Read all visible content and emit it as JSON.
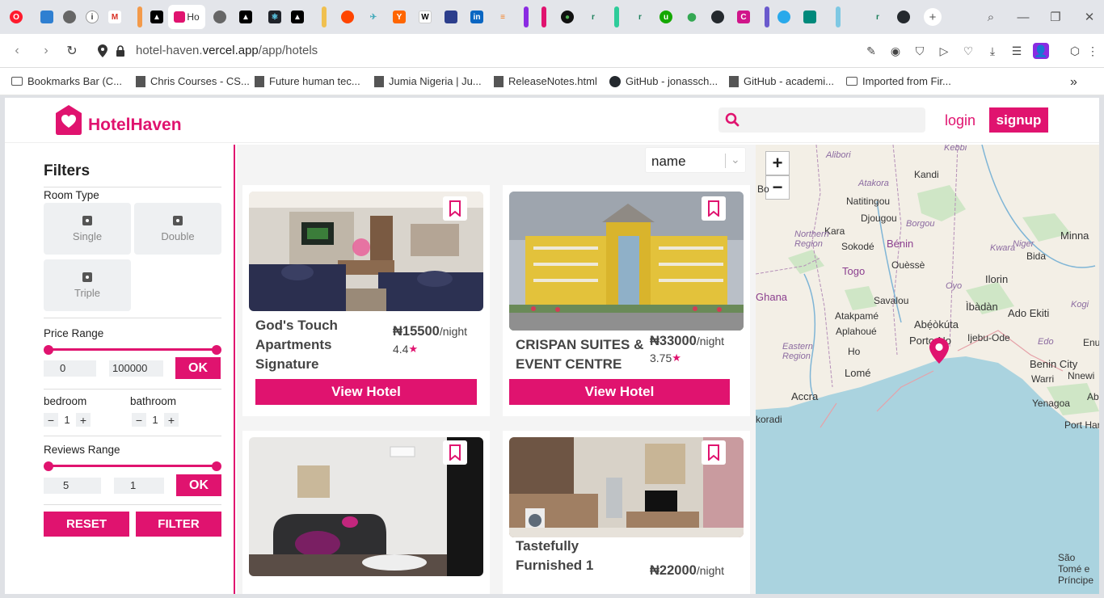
{
  "browser": {
    "active_tab_title": "Ho",
    "url_host": "hotel-haven.",
    "url_domain": "vercel.app",
    "url_path": "/app/hotels",
    "bookmarks": [
      "Bookmarks Bar (C...",
      "Chris Courses - CS...",
      "Future human tec...",
      "Jumia Nigeria | Ju...",
      "ReleaseNotes.html",
      "GitHub - jonassch...",
      "GitHub - academi...",
      "Imported from Fir..."
    ]
  },
  "header": {
    "brand": "HotelHaven",
    "search_placeholder": "",
    "login": "login",
    "signup": "signup"
  },
  "filters": {
    "title": "Filters",
    "room_type_label": "Room Type",
    "room_types": [
      "Single",
      "Double",
      "Triple"
    ],
    "price_range_label": "Price Range",
    "price_min": "0",
    "price_max": "100000",
    "ok": "OK",
    "bedroom_label": "bedroom",
    "bedroom_value": "1",
    "bathroom_label": "bathroom",
    "bathroom_value": "1",
    "minus": "−",
    "plus": "+",
    "reviews_range_label": "Reviews Range",
    "reviews_min": "5",
    "reviews_max": "1",
    "reset": "RESET",
    "filter": "FILTER"
  },
  "sort": {
    "selected": "name"
  },
  "hotels": [
    {
      "name": "God's Touch Apartments Signature",
      "currency": "₦",
      "price": "15500",
      "unit": "/night",
      "rating": "4.4",
      "button": "View Hotel"
    },
    {
      "name": "CRISPAN SUITES & EVENT CENTRE",
      "currency": "₦",
      "price": "33000",
      "unit": "/night",
      "rating": "3.75",
      "button": "View Hotel"
    },
    {
      "name": "",
      "price": "",
      "rating": "",
      "button": ""
    },
    {
      "name": "Tastefully Furnished 1",
      "currency": "₦",
      "price": "22000",
      "unit": "/night",
      "rating": "",
      "button": ""
    }
  ],
  "map": {
    "zoom_in": "+",
    "zoom_out": "−",
    "labels": {
      "alibori": "Alibori",
      "kebbi": "Kebbi",
      "kandi": "Kandi",
      "atakora": "Atakora",
      "bo": "Bo",
      "natitingou": "Natitingou",
      "kara": "Kara",
      "djougou": "Djougou",
      "borgou": "Borgou",
      "northern_region": "Northern Region",
      "benin": "Bénin",
      "sokode": "Sokodé",
      "niger": "Niger",
      "minna": "Minna",
      "kwara": "Kwara",
      "bida": "Bida",
      "togo": "Togo",
      "ouesse": "Ouèssè",
      "oyo": "Oyo",
      "ilorin": "Ilorin",
      "ghana": "Ghana",
      "savalou": "Savalou",
      "ibadan": "Ìbàdàn",
      "ado_ekiti": "Ado Ekiti",
      "kogi": "Kogi",
      "atakpame": "Atakpamé",
      "abeokuta": "Abẹ́òkúta",
      "aplahoue": "Aplahoué",
      "ijebu_ode": "Ijebu-Ode",
      "eastern_region": "Eastern Region",
      "ho": "Ho",
      "porto_novo": "Porto-No",
      "edo": "Edo",
      "enu": "Enu",
      "lome": "Lomé",
      "benin_city": "Benin City",
      "warri": "Warri",
      "nnewi": "Nnewi",
      "accra": "Accra",
      "yenagoa": "Yenagoa",
      "ab": "Ab",
      "koradi": "koradi",
      "port_harcourt": "Port Harc",
      "sao_tome": "São Tomé e Príncipe"
    }
  },
  "colors": {
    "accent": "#e0136f",
    "map_sea": "#aad3df",
    "map_land": "#f3efe6"
  }
}
